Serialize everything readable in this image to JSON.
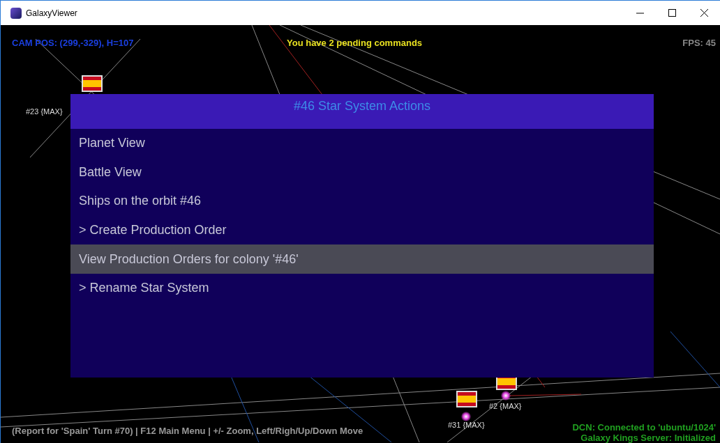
{
  "window": {
    "title": "GalaxyViewer"
  },
  "hud": {
    "camera": "CAM POS: (299,-329), H=107",
    "pending": "You have 2 pending commands",
    "fps": "FPS: 45",
    "help": "(Report for 'Spain' Turn #70) | F12 Main Menu | +/- Zoom, Left/Righ/Up/Down Move",
    "connection": "DCN: Connected to 'ubuntu/1024'",
    "server": "Galaxy Kings Server: Initialized"
  },
  "systems": [
    {
      "label": "#23 {MAX}"
    },
    {
      "label": "#2 {MAX}"
    },
    {
      "label": "#31 {MAX}"
    }
  ],
  "menu": {
    "title": "#46 Star System Actions",
    "items": [
      {
        "label": "Planet View",
        "selected": false
      },
      {
        "label": "Battle View",
        "selected": false
      },
      {
        "label": "Ships on the orbit #46",
        "selected": false
      },
      {
        "label": "> Create Production Order",
        "selected": false
      },
      {
        "label": "View Production Orders for colony '#46'",
        "selected": true
      },
      {
        "label": "> Rename Star System",
        "selected": false
      }
    ]
  }
}
